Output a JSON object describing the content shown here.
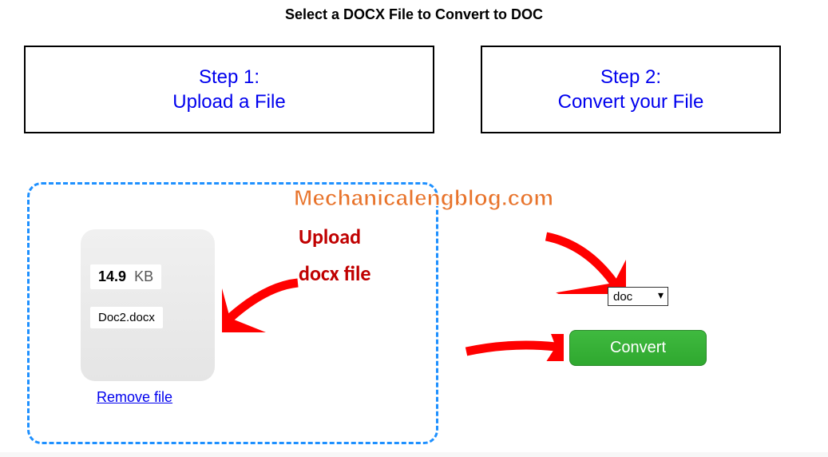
{
  "title": "Select a DOCX File to Convert to DOC",
  "steps": {
    "step1": {
      "line1": "Step 1:",
      "line2": "Upload a File"
    },
    "step2": {
      "line1": "Step 2:",
      "line2": "Convert your File"
    }
  },
  "file": {
    "size_value": "14.9",
    "size_unit": "KB",
    "name": "Doc2.docx",
    "remove_label": "Remove file"
  },
  "watermark": "Mechanicalengblog.com",
  "annotation": {
    "line1": "Upload",
    "line2": "docx file"
  },
  "format": {
    "selected": "doc"
  },
  "convert": {
    "label": "Convert"
  },
  "colors": {
    "link": "#0000EE",
    "annotation": "#C00000",
    "button": "#3FB93F",
    "dash": "#1E90FF",
    "watermark": "#E8742C"
  }
}
